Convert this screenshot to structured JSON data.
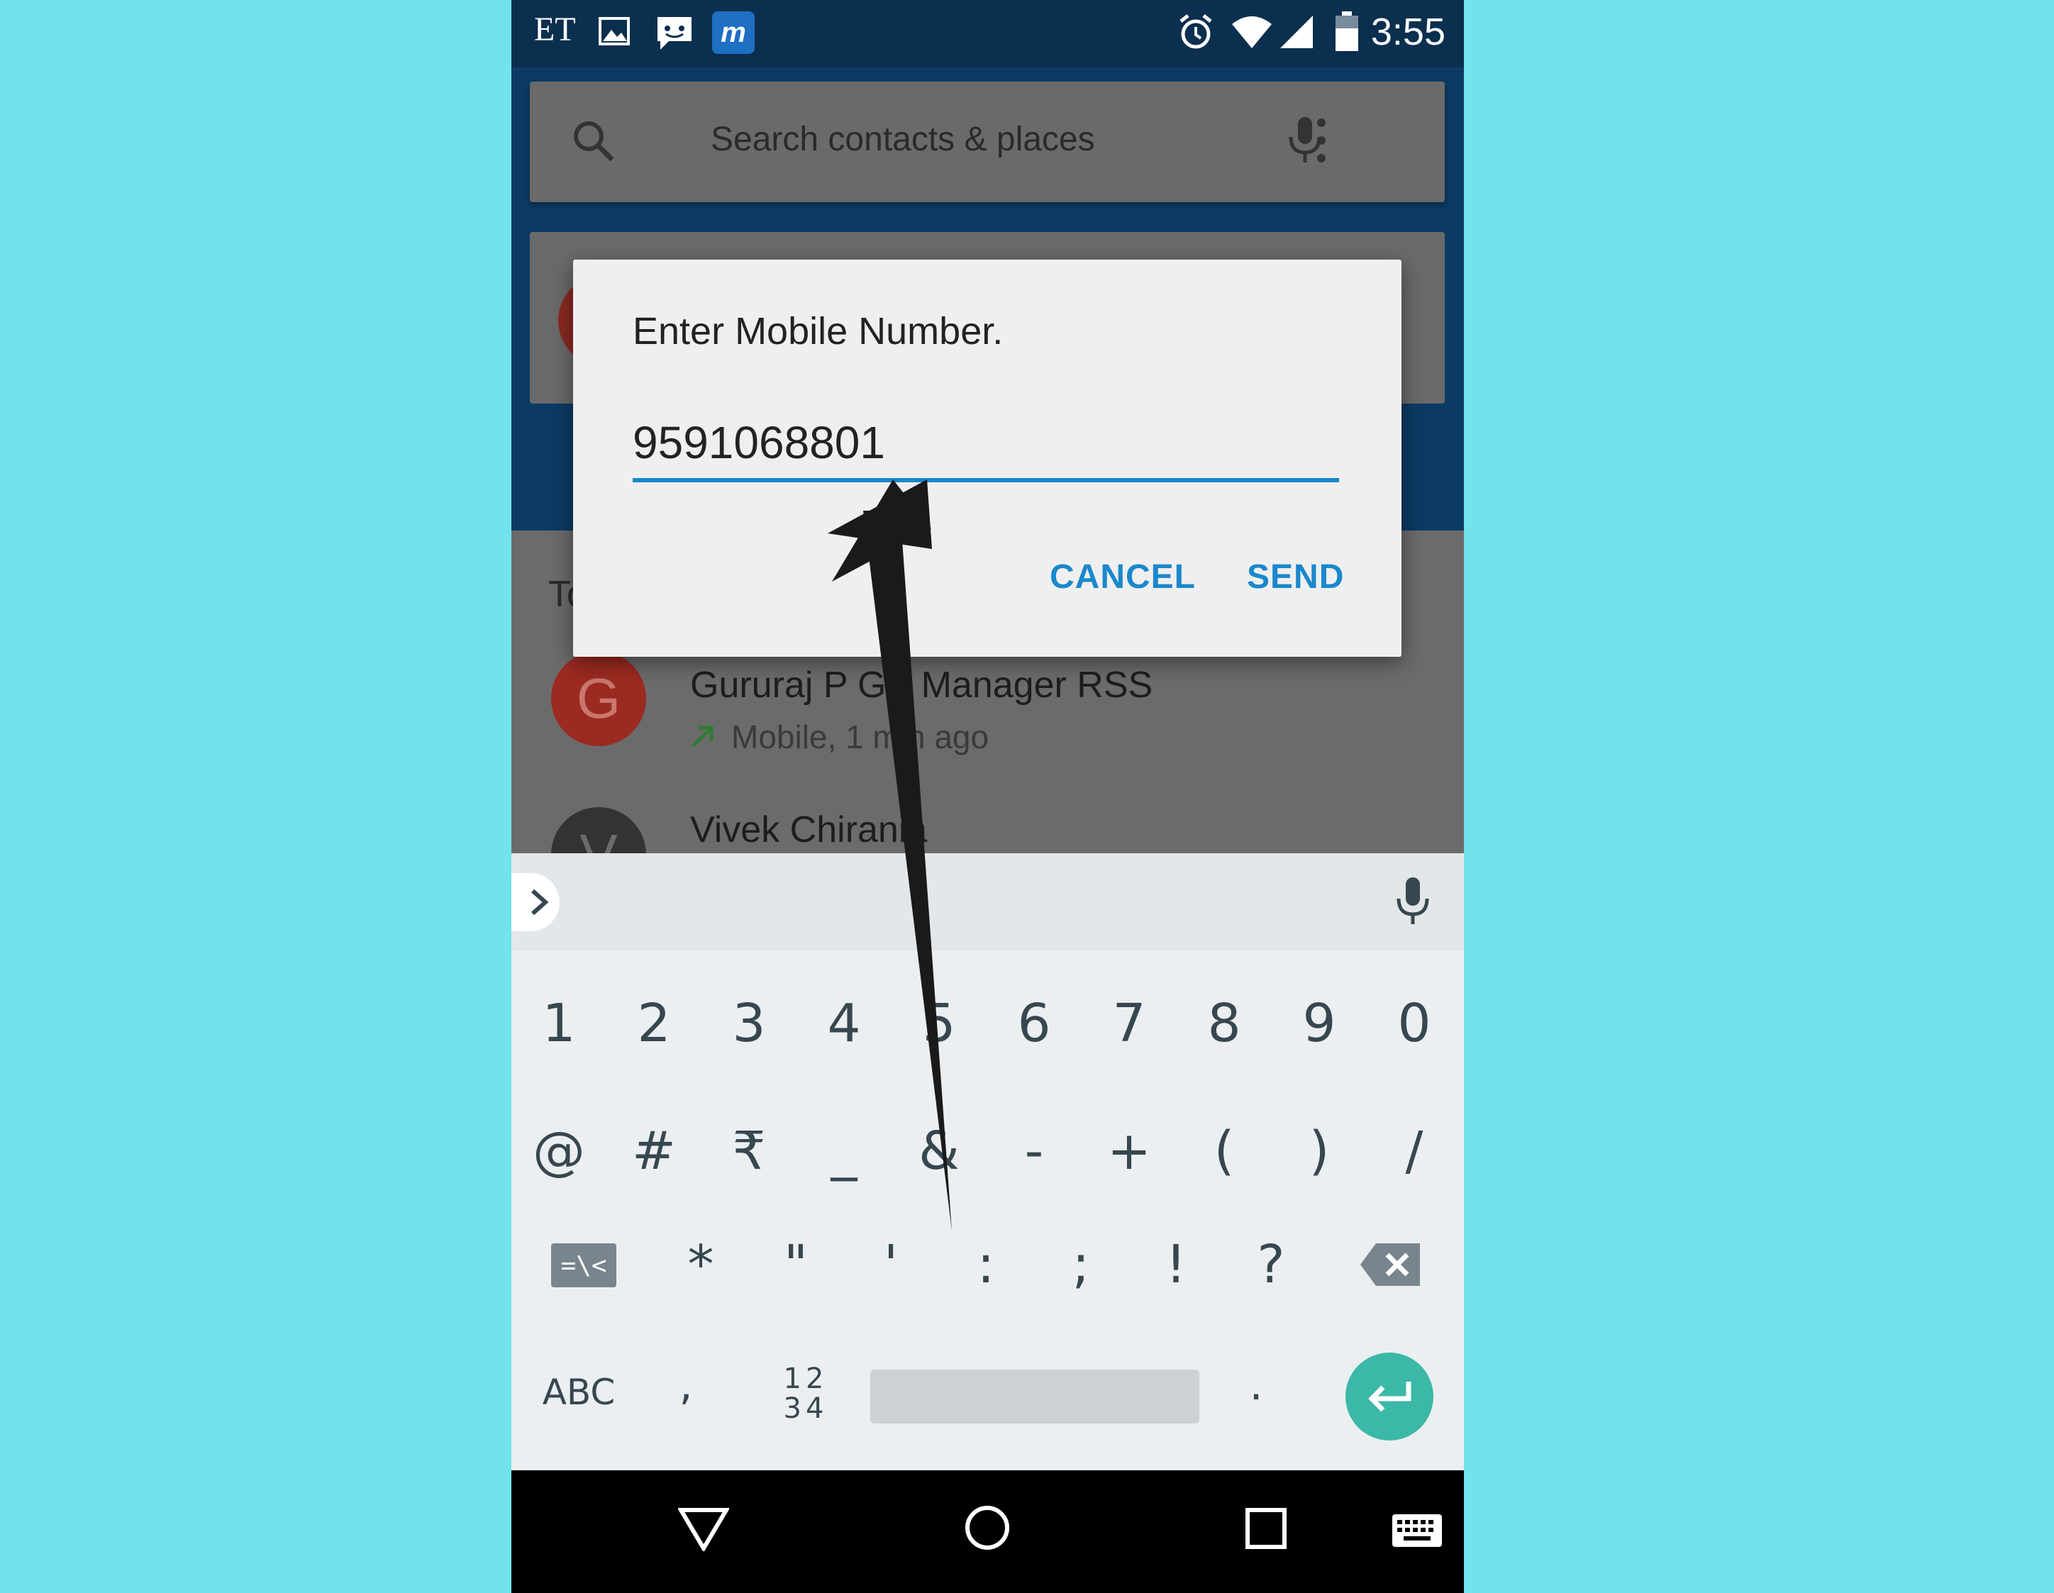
{
  "status_bar": {
    "time": "3:55",
    "left_icons": [
      "et-app-icon",
      "gallery-icon",
      "messenger-icon",
      "moneycontrol-icon"
    ],
    "left_text": "ET",
    "m_icon_text": "m",
    "right_icons": [
      "alarm-icon",
      "wifi-icon",
      "signal-icon",
      "battery-icon"
    ]
  },
  "search": {
    "placeholder": "Search contacts & places"
  },
  "background_list": {
    "section_header_partial": "To",
    "items": [
      {
        "initial": "G",
        "name": "Gururaj P GB Manager RSS",
        "detail": "Mobile, 1 min ago",
        "avatar_color": "#9b2a21"
      },
      {
        "initial": "V",
        "name": "Vivek Chirania",
        "avatar_color": "#333333"
      }
    ]
  },
  "dialog": {
    "title": "Enter Mobile Number.",
    "input_value": "9591068801",
    "cancel_label": "CANCEL",
    "send_label": "SEND"
  },
  "keyboard": {
    "row1": [
      "1",
      "2",
      "3",
      "4",
      "5",
      "6",
      "7",
      "8",
      "9",
      "0"
    ],
    "row2": [
      "@",
      "#",
      "₹",
      "_",
      "&",
      "-",
      "+",
      "(",
      ")",
      "/"
    ],
    "row3": [
      "=\\<",
      "*",
      "\"",
      "'",
      ":",
      ";",
      "!",
      "?"
    ],
    "row4": {
      "abc": "ABC",
      "comma": ",",
      "numpad_top": "12",
      "numpad_bottom": "34",
      "period": "."
    }
  },
  "colors": {
    "background": "#72e2ec",
    "status_bar": "#0b2f4e",
    "header": "#0b3b64",
    "accent": "#1a88cc",
    "enter_key": "#3bb8a7"
  }
}
